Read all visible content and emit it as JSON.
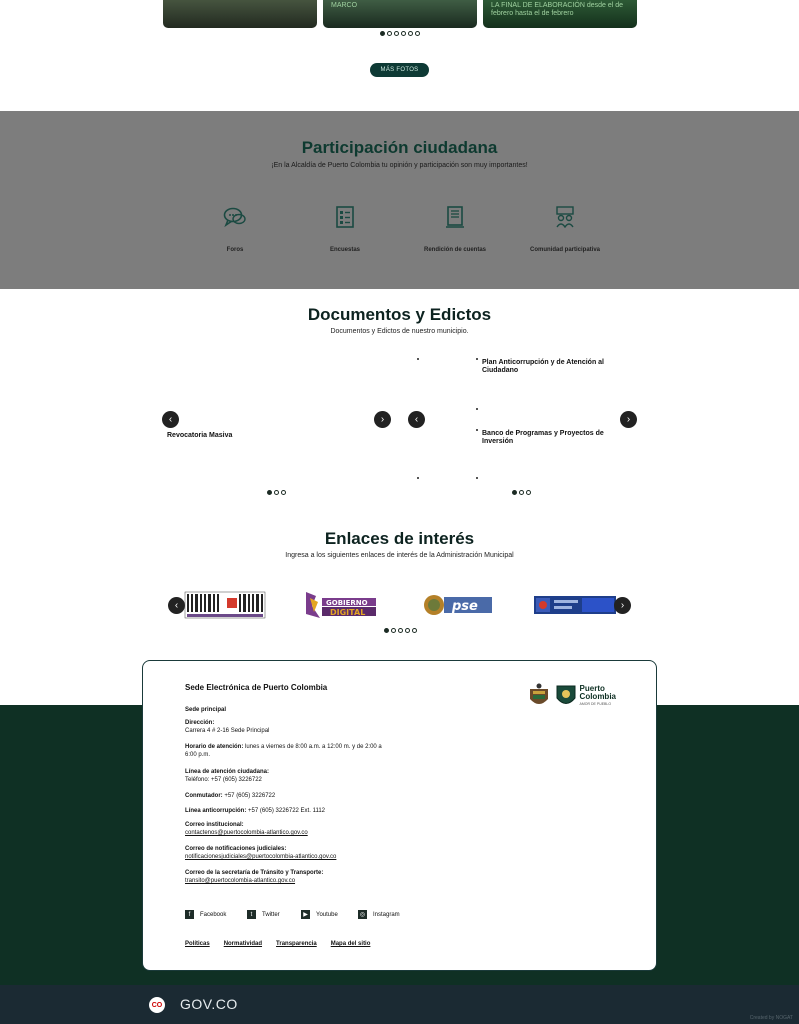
{
  "gallery": {
    "cards": [
      {
        "caption": ""
      },
      {
        "caption": "MARCO"
      },
      {
        "caption": "LA FINAL DE ELABORACIÓN desde el de febrero hasta el de febrero"
      }
    ],
    "dots": 6,
    "active_dot": 0,
    "more_photos_label": "MÁS FOTOS"
  },
  "participation": {
    "title": "Participación ciudadana",
    "subtitle": "¡En la Alcaldía de Puerto Colombia tu opinión y participación son muy importantes!",
    "items": [
      {
        "label": "Foros",
        "icon": "chat-bubbles-icon"
      },
      {
        "label": "Encuestas",
        "icon": "survey-list-icon"
      },
      {
        "label": "Rendición de cuentas",
        "icon": "book-report-icon"
      },
      {
        "label": "Comunidad participativa",
        "icon": "community-people-icon"
      }
    ]
  },
  "documents": {
    "title": "Documentos y Edictos",
    "subtitle": "Documentos y Edictos de nuestro municipio.",
    "left_carousel": {
      "item": "Revocatoria Masiva",
      "dots": 3,
      "active_dot": 0
    },
    "right_carousel": {
      "items": [
        "Plan Anticorrupción y de Atención al Ciudadano",
        "Banco de Programas y Proyectos de Inversión"
      ],
      "dots": 3,
      "active_dot": 0
    }
  },
  "links": {
    "title": "Enlaces de interés",
    "subtitle": "Ingresa a los siguientes enlaces de interés de la Administración Municipal",
    "logos": [
      {
        "name": "Gobierno en Línea",
        "icon": "govline-logo"
      },
      {
        "name": "Gobierno Digital",
        "icon": "gobierno-digital-logo"
      },
      {
        "name": "PSE",
        "icon": "pse-logo"
      },
      {
        "name": "Portal",
        "icon": "portal-logo"
      }
    ],
    "dots": 5,
    "active_dot": 0
  },
  "footer": {
    "title": "Sede Electrónica de Puerto Colombia",
    "main_office": "Sede principal",
    "address_label": "Dirección:",
    "address": "Carrera 4 # 2-16 Sede Principal",
    "hours_label": "Horario de atención:",
    "hours": "lunes a viernes de 8:00 a.m. a 12:00 m. y de 2:00 a 6:00 p.m.",
    "service_line_label": "Línea de atención ciudadana:",
    "service_line": "Teléfono: +57 (605) 3226722",
    "switchboard_label": "Conmutador:",
    "switchboard": "+57 (605) 3226722",
    "anticorruption_label": "Línea anticorrupción:",
    "anticorruption": "+57 (605) 3226722 Ext. 1112",
    "email_label": "Correo institucional:",
    "email": "contactenos@puertocolombia-atlantico.gov.co",
    "judicial_label": "Correo de notificaciones judiciales:",
    "judicial_email": "notificacionesjudiciales@puertocolombia-atlantico.gov.co",
    "transit_label": "Correo de la secretaría de Tránsito y Transporte:",
    "transit_email": "transito@puertocolombia-atlantico.gov.co",
    "social": [
      {
        "label": "Facebook",
        "icon": "facebook-icon",
        "glyph": "f"
      },
      {
        "label": "Twitter",
        "icon": "twitter-icon",
        "glyph": "t"
      },
      {
        "label": "Youtube",
        "icon": "youtube-icon",
        "glyph": "▶"
      },
      {
        "label": "Instagram",
        "icon": "instagram-icon",
        "glyph": "◎"
      }
    ],
    "bottom_links": [
      "Políticas",
      "Normatividad",
      "Transparencia",
      "Mapa del sitio"
    ],
    "brand_name_1": "Puerto",
    "brand_name_2": "Colombia",
    "brand_tagline": "AMOR DE PUEBLO"
  },
  "govbar": {
    "badge": "CO",
    "text": "GOV.CO",
    "credit": "Created by NOGAT"
  }
}
